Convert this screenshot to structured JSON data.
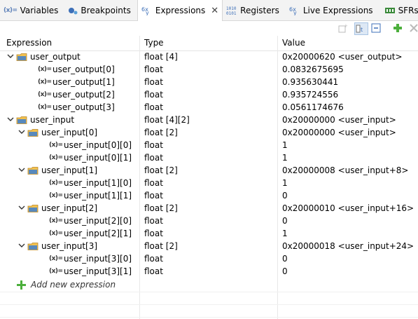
{
  "tabs": [
    {
      "label": "Variables",
      "icon": "variables-icon",
      "active": false
    },
    {
      "label": "Breakpoints",
      "icon": "breakpoints-icon",
      "active": false
    },
    {
      "label": "Expressions",
      "icon": "expressions-icon",
      "active": true
    },
    {
      "label": "Registers",
      "icon": "registers-icon",
      "active": false
    },
    {
      "label": "Live Expressions",
      "icon": "live-expressions-icon",
      "active": false
    },
    {
      "label": "SFRs",
      "icon": "sfrs-icon",
      "active": false
    }
  ],
  "tab_icons": {
    "variables": "(x)=",
    "registers": "1010\n0101"
  },
  "columns": {
    "expression": "Expression",
    "type": "Type",
    "value": "Value"
  },
  "rows": [
    {
      "name": "user_output",
      "type": "float [4]",
      "value": "0x20000620 <user_output>"
    },
    {
      "name": "user_output[0]",
      "type": "float",
      "value": "0.0832675695"
    },
    {
      "name": "user_output[1]",
      "type": "float",
      "value": "0.935630441"
    },
    {
      "name": "user_output[2]",
      "type": "float",
      "value": "0.935724556"
    },
    {
      "name": "user_output[3]",
      "type": "float",
      "value": "0.0561174676"
    },
    {
      "name": "user_input",
      "type": "float [4][2]",
      "value": "0x20000000 <user_input>"
    },
    {
      "name": "user_input[0]",
      "type": "float [2]",
      "value": "0x20000000 <user_input>"
    },
    {
      "name": "user_input[0][0]",
      "type": "float",
      "value": "1"
    },
    {
      "name": "user_input[0][1]",
      "type": "float",
      "value": "1"
    },
    {
      "name": "user_input[1]",
      "type": "float [2]",
      "value": "0x20000008 <user_input+8>"
    },
    {
      "name": "user_input[1][0]",
      "type": "float",
      "value": "1"
    },
    {
      "name": "user_input[1][1]",
      "type": "float",
      "value": "0"
    },
    {
      "name": "user_input[2]",
      "type": "float [2]",
      "value": "0x20000010 <user_input+16>"
    },
    {
      "name": "user_input[2][0]",
      "type": "float",
      "value": "0"
    },
    {
      "name": "user_input[2][1]",
      "type": "float",
      "value": "1"
    },
    {
      "name": "user_input[3]",
      "type": "float [2]",
      "value": "0x20000018 <user_input+24>"
    },
    {
      "name": "user_input[3][0]",
      "type": "float",
      "value": "0"
    },
    {
      "name": "user_input[3][1]",
      "type": "float",
      "value": "0"
    }
  ],
  "add_new": "Add new expression",
  "colors": {
    "accent": "#4a6fa5",
    "folder": "#e8b53c",
    "add": "#4caf3c"
  }
}
